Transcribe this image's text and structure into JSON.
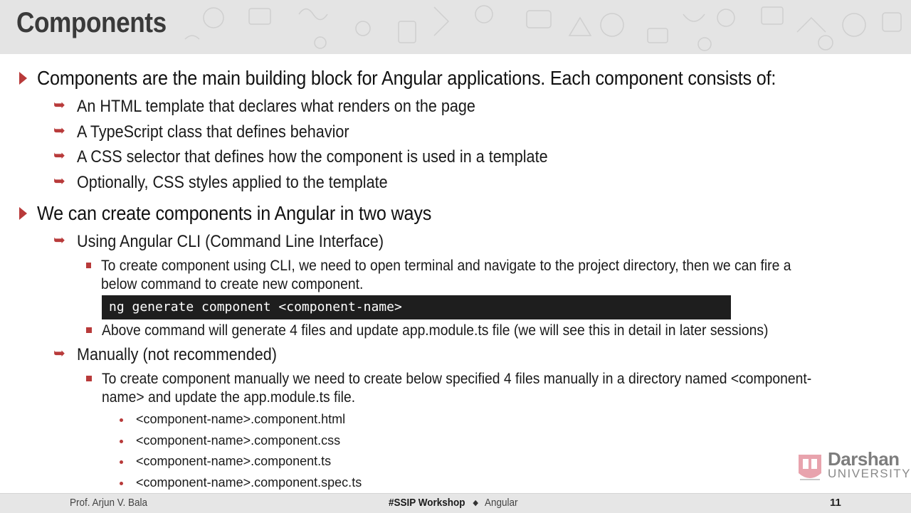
{
  "slide": {
    "title": "Components"
  },
  "content": {
    "bullet1": "Components are the main building block for Angular applications. Each component consists of:",
    "bullet1_items": [
      "An HTML template that declares what renders on the page",
      "A TypeScript class that defines behavior",
      "A CSS selector that defines how the component is used in a template",
      "Optionally, CSS styles applied to the template"
    ],
    "bullet2": "We can create components in Angular in two ways",
    "cli": {
      "label": "Using Angular CLI (Command Line Interface)",
      "step1_line1": "To create component using CLI, we need to open terminal and navigate to the project directory, then we can fire a",
      "step1_line2": "below command to create new component.",
      "command": "ng generate component <component-name>",
      "step2": "Above command will generate 4 files and update app.module.ts file (we will see this in detail in later sessions)"
    },
    "manual": {
      "label": "Manually (not recommended)",
      "step_line1": "To create component manually we need to create below specified 4 files manually in a directory named <component-",
      "step_line2": "name> and update the app.module.ts file.",
      "files": [
        "<component-name>.component.html",
        "<component-name>.component.css",
        "<component-name>.component.ts",
        "<component-name>.component.spec.ts"
      ]
    }
  },
  "logo": {
    "name": "Darshan",
    "sub": "UNIVERSITY"
  },
  "footer": {
    "author": "Prof. Arjun V. Bala",
    "event": "#SSIP Workshop",
    "topic": "Angular",
    "page": "11"
  },
  "colors": {
    "accent": "#b83a3a",
    "header_bg": "#e4e4e4",
    "code_bg": "#1e1e1e"
  }
}
